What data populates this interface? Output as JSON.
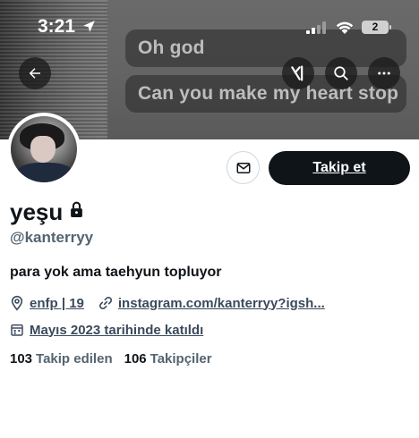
{
  "status_bar": {
    "time": "3:21",
    "battery": "2"
  },
  "banner": {
    "captions": [
      "Oh god",
      "Can you make my heart stop"
    ]
  },
  "profile": {
    "display_name": "yeşu",
    "handle": "@kanterryy",
    "bio": "para yok ama taehyun topluyor",
    "location": "enfp | 19",
    "website": "instagram.com/kanterryy?igsh...",
    "joined": "Mayıs 2023 tarihinde katıldı",
    "following_count": "103",
    "following_label": "Takip edilen",
    "followers_count": "106",
    "followers_label": "Takipçiler"
  },
  "actions": {
    "follow_label": "Takip et"
  },
  "icons": {
    "back": "back-arrow-icon",
    "grok": "grok-icon",
    "search": "search-icon",
    "more": "more-icon",
    "mail": "mail-icon",
    "lock": "lock-icon",
    "location": "location-pin-icon",
    "link": "link-icon",
    "calendar": "calendar-icon"
  },
  "colors": {
    "primary_text": "#0f1419",
    "secondary_text": "#536471",
    "follow_button": "#0f1419"
  }
}
